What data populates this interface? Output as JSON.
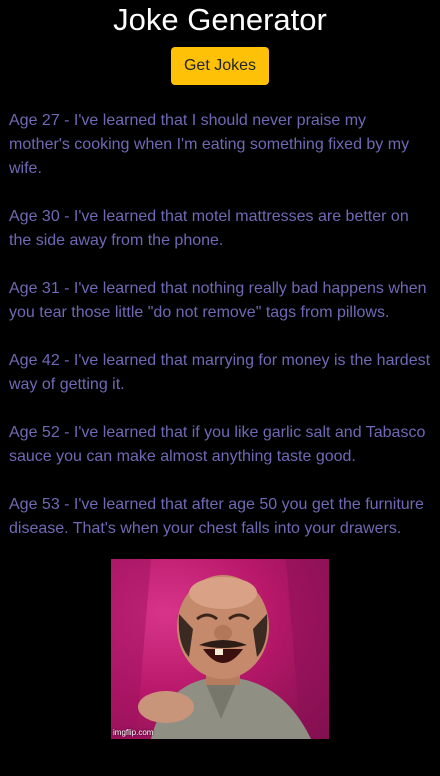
{
  "header": {
    "title": "Joke Generator",
    "button_label": "Get Jokes"
  },
  "jokes": [
    "Age 27 - I've learned that I should never praise my mother's cooking when I'm eating something fixed by my wife.",
    "Age 30 - I've learned that motel mattresses are better on the side away from the phone.",
    "Age 31 - I've learned that nothing really bad happens when you tear those little \"do not remove\" tags from pillows.",
    "Age 42 - I've learned that marrying for money is the hardest way of getting it.",
    "Age 52 - I've learned that if you like garlic salt and Tabasco sauce you can make almost anything taste good.",
    "Age 53 - I've learned that after age 50 you get the furniture disease. That's when your chest falls into your drawers."
  ],
  "meme": {
    "watermark": "imgflip.com",
    "description_icon": "laughing-man-gif"
  },
  "colors": {
    "background": "#000000",
    "title": "#ffffff",
    "button_bg": "#ffc107",
    "joke_text": "#6f69b5"
  }
}
